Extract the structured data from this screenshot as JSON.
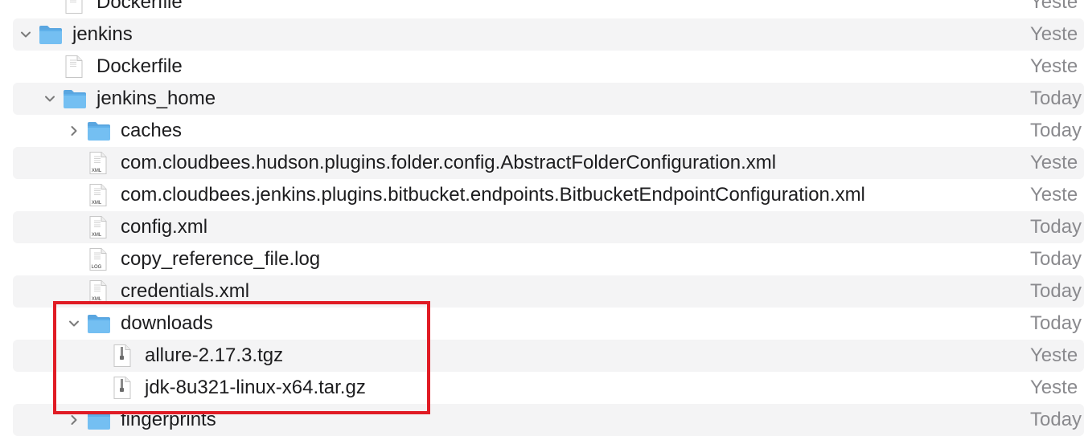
{
  "rows": [
    {
      "name": "Dockerfile",
      "type": "file",
      "date": "Yeste",
      "depth": 1
    },
    {
      "name": "jenkins",
      "type": "folder",
      "date": "Yeste",
      "depth": 0,
      "expanded": true
    },
    {
      "name": "Dockerfile",
      "type": "file",
      "date": "Yeste",
      "depth": 1
    },
    {
      "name": "jenkins_home",
      "type": "folder",
      "date": "Today",
      "depth": 1,
      "expanded": true
    },
    {
      "name": "caches",
      "type": "folder",
      "date": "Today",
      "depth": 2,
      "expanded": false
    },
    {
      "name": "com.cloudbees.hudson.plugins.folder.config.AbstractFolderConfiguration.xml",
      "type": "xml",
      "date": "Yeste",
      "depth": 2
    },
    {
      "name": "com.cloudbees.jenkins.plugins.bitbucket.endpoints.BitbucketEndpointConfiguration.xml",
      "type": "xml",
      "date": "Yeste",
      "depth": 2
    },
    {
      "name": "config.xml",
      "type": "xml",
      "date": "Today",
      "depth": 2
    },
    {
      "name": "copy_reference_file.log",
      "type": "log",
      "date": "Today",
      "depth": 2
    },
    {
      "name": "credentials.xml",
      "type": "xml",
      "date": "Today",
      "depth": 2
    },
    {
      "name": "downloads",
      "type": "folder",
      "date": "Today",
      "depth": 2,
      "expanded": true
    },
    {
      "name": "allure-2.17.3.tgz",
      "type": "archive",
      "date": "Yeste",
      "depth": 3
    },
    {
      "name": "jdk-8u321-linux-x64.tar.gz",
      "type": "archive",
      "date": "Yeste",
      "depth": 3
    },
    {
      "name": "fingerprints",
      "type": "folder",
      "date": "Today",
      "depth": 2,
      "expanded": false
    }
  ],
  "doc_labels": {
    "xml": "XML",
    "log": "LOG"
  },
  "colors": {
    "highlight": "#e01b24",
    "folder": "#6cb8ee",
    "stripe": "#f4f4f5"
  }
}
